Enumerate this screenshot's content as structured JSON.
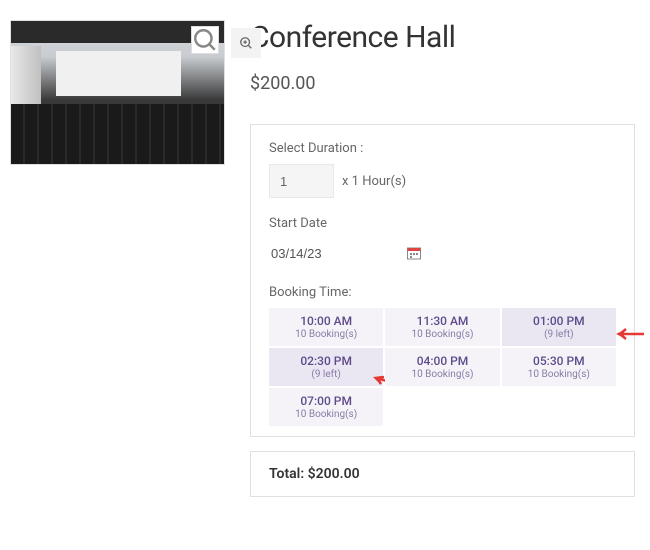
{
  "product": {
    "title": "Conference Hall",
    "price": "$200.00"
  },
  "booking": {
    "duration_label": "Select Duration :",
    "duration_value": "1",
    "duration_suffix": "x 1 Hour(s)",
    "start_date_label": "Start Date",
    "start_date_value": "03/14/23",
    "time_label": "Booking Time:"
  },
  "slots": [
    {
      "time": "10:00 AM",
      "sub": "10 Booking(s)",
      "highlight": false
    },
    {
      "time": "11:30 AM",
      "sub": "10 Booking(s)",
      "highlight": false
    },
    {
      "time": "01:00 PM",
      "sub": "(9 left)",
      "highlight": true,
      "arrow": "right"
    },
    {
      "time": "02:30 PM",
      "sub": "(9 left)",
      "highlight": true,
      "arrow": "below"
    },
    {
      "time": "04:00 PM",
      "sub": "10 Booking(s)",
      "highlight": false
    },
    {
      "time": "05:30 PM",
      "sub": "10 Booking(s)",
      "highlight": false
    },
    {
      "time": "07:00 PM",
      "sub": "10 Booking(s)",
      "highlight": false
    }
  ],
  "total": {
    "label": "Total:",
    "value": "$200.00"
  },
  "icons": {
    "zoom": "search-icon",
    "calendar": "calendar-icon"
  }
}
